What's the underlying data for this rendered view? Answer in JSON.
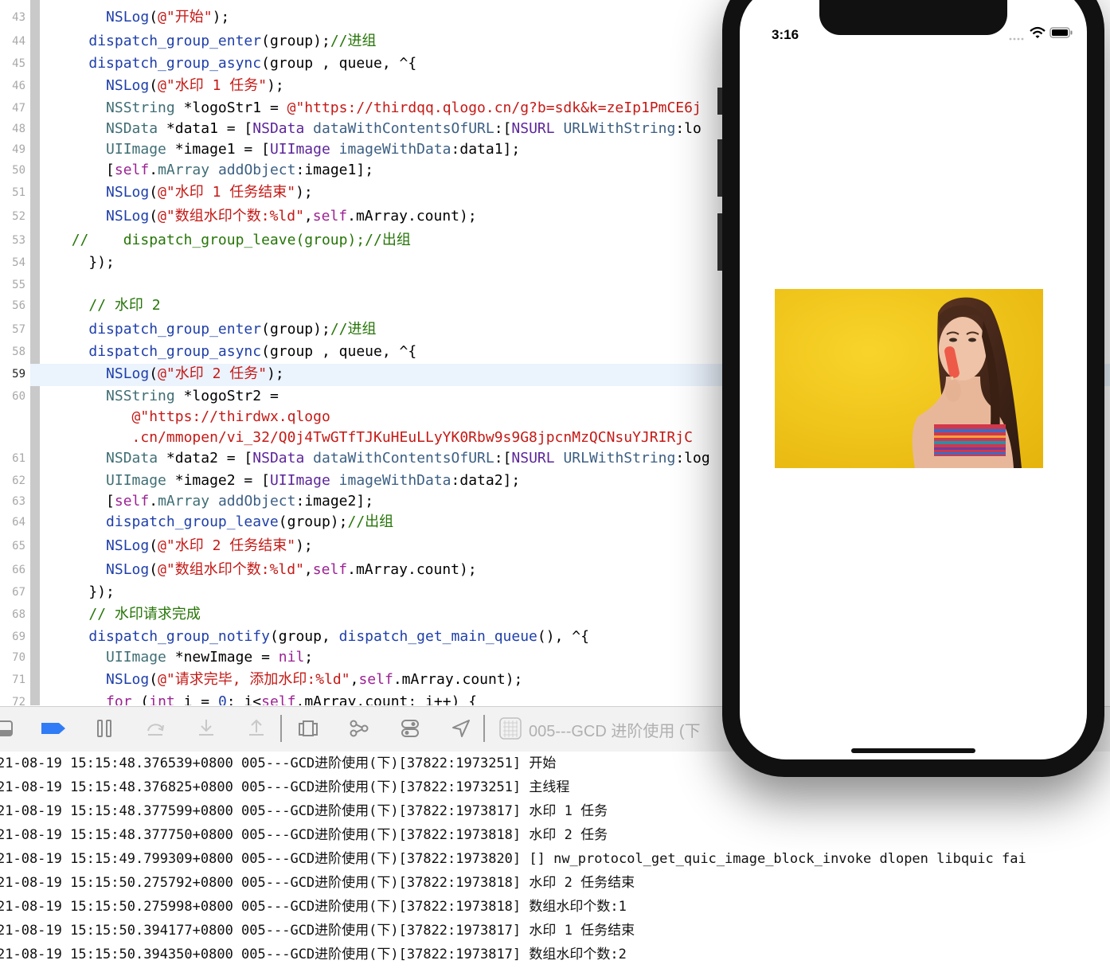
{
  "editor": {
    "lines": [
      {
        "n": "43",
        "segs": [
          [
            "NSLog",
            "fn"
          ],
          [
            "(",
            ""
          ],
          [
            "@\"开始\"",
            "str"
          ],
          [
            ");",
            ""
          ]
        ],
        "indent": "      "
      },
      {
        "n": "44",
        "segs": [
          [
            "dispatch_group_enter",
            "fn"
          ],
          [
            "(group);",
            ""
          ],
          [
            "//进组",
            "cm"
          ]
        ],
        "indent": "    "
      },
      {
        "n": "45",
        "segs": [
          [
            "dispatch_group_async",
            "fn"
          ],
          [
            "(group , queue, ^{",
            ""
          ]
        ],
        "indent": "    "
      },
      {
        "n": "46",
        "segs": [
          [
            "NSLog",
            "fn"
          ],
          [
            "(",
            ""
          ],
          [
            "@\"水印 1 任务\"",
            "str"
          ],
          [
            ");",
            ""
          ]
        ],
        "indent": "      "
      },
      {
        "n": "47",
        "segs": [
          [
            "NSString",
            "cls"
          ],
          [
            " *logoStr1 = ",
            ""
          ],
          [
            "@\"https://thirdqq.qlogo.cn/g?b=sdk&k=zeIp1PmCE6j",
            "str"
          ]
        ],
        "indent": "      "
      },
      {
        "n": "48",
        "segs": [
          [
            "NSData",
            "cls"
          ],
          [
            " *data1 = [",
            ""
          ],
          [
            "NSData",
            "cls2"
          ],
          [
            " ",
            ""
          ],
          [
            "dataWithContentsOfURL",
            "meth"
          ],
          [
            ":[",
            ""
          ],
          [
            "NSURL",
            "cls2"
          ],
          [
            " ",
            ""
          ],
          [
            "URLWithString",
            "meth"
          ],
          [
            ":lo",
            ""
          ]
        ],
        "indent": "      "
      },
      {
        "n": "49",
        "segs": [
          [
            "UIImage",
            "cls"
          ],
          [
            " *image1 = [",
            ""
          ],
          [
            "UIImage",
            "cls2"
          ],
          [
            " ",
            ""
          ],
          [
            "imageWithData",
            "meth"
          ],
          [
            ":data1];",
            ""
          ]
        ],
        "indent": "      "
      },
      {
        "n": "50",
        "segs": [
          [
            "[",
            ""
          ],
          [
            "self",
            "kw"
          ],
          [
            ".",
            ""
          ],
          [
            "mArray",
            "prop"
          ],
          [
            " ",
            ""
          ],
          [
            "addObject",
            "meth"
          ],
          [
            ":image1];",
            ""
          ]
        ],
        "indent": "      "
      },
      {
        "n": "51",
        "segs": [
          [
            "NSLog",
            "fn"
          ],
          [
            "(",
            ""
          ],
          [
            "@\"水印 1 任务结束\"",
            "str"
          ],
          [
            ");",
            ""
          ]
        ],
        "indent": "      "
      },
      {
        "n": "52",
        "segs": [
          [
            "NSLog",
            "fn"
          ],
          [
            "(",
            ""
          ],
          [
            "@\"数组水印个数:%ld\"",
            "str"
          ],
          [
            ",",
            ""
          ],
          [
            "self",
            "kw"
          ],
          [
            ".mArray.count);",
            ""
          ]
        ],
        "indent": "      "
      },
      {
        "n": "53",
        "segs": [
          [
            "//    dispatch_group_leave(group);//出组",
            "cm"
          ]
        ],
        "indent": "  "
      },
      {
        "n": "54",
        "segs": [
          [
            "});",
            ""
          ]
        ],
        "indent": "    "
      },
      {
        "n": "55",
        "segs": [],
        "indent": ""
      },
      {
        "n": "56",
        "segs": [
          [
            "// 水印 2",
            "cm"
          ]
        ],
        "indent": "    "
      },
      {
        "n": "57",
        "segs": [
          [
            "dispatch_group_enter",
            "fn"
          ],
          [
            "(group);",
            ""
          ],
          [
            "//进组",
            "cm"
          ]
        ],
        "indent": "    "
      },
      {
        "n": "58",
        "segs": [
          [
            "dispatch_group_async",
            "fn"
          ],
          [
            "(group , queue, ^{",
            ""
          ]
        ],
        "indent": "    "
      },
      {
        "n": "59",
        "segs": [
          [
            "NSLog",
            "fn"
          ],
          [
            "(",
            ""
          ],
          [
            "@\"水印 2 任务\"",
            "str"
          ],
          [
            ");",
            ""
          ]
        ],
        "indent": "      "
      },
      {
        "n": "60",
        "segs": [
          [
            "NSString",
            "cls"
          ],
          [
            " *logoStr2 =",
            ""
          ]
        ],
        "indent": "      "
      },
      {
        "n": "",
        "segs": [
          [
            "@\"https://thirdwx.qlogo",
            "str"
          ]
        ],
        "indent": "         "
      },
      {
        "n": "",
        "segs": [
          [
            ".cn/mmopen/vi_32/Q0j4TwGTfTJKuHEuLLyYK0Rbw9s9G8jpcnMzQCNsuYJRIRjC",
            "str"
          ]
        ],
        "indent": "         "
      },
      {
        "n": "61",
        "segs": [
          [
            "NSData",
            "cls"
          ],
          [
            " *data2 = [",
            ""
          ],
          [
            "NSData",
            "cls2"
          ],
          [
            " ",
            ""
          ],
          [
            "dataWithContentsOfURL",
            "meth"
          ],
          [
            ":[",
            ""
          ],
          [
            "NSURL",
            "cls2"
          ],
          [
            " ",
            ""
          ],
          [
            "URLWithString",
            "meth"
          ],
          [
            ":log",
            ""
          ]
        ],
        "indent": "      "
      },
      {
        "n": "62",
        "segs": [
          [
            "UIImage",
            "cls"
          ],
          [
            " *image2 = [",
            ""
          ],
          [
            "UIImage",
            "cls2"
          ],
          [
            " ",
            ""
          ],
          [
            "imageWithData",
            "meth"
          ],
          [
            ":data2];",
            ""
          ]
        ],
        "indent": "      "
      },
      {
        "n": "63",
        "segs": [
          [
            "[",
            ""
          ],
          [
            "self",
            "kw"
          ],
          [
            ".",
            ""
          ],
          [
            "mArray",
            "prop"
          ],
          [
            " ",
            ""
          ],
          [
            "addObject",
            "meth"
          ],
          [
            ":image2];",
            ""
          ]
        ],
        "indent": "      "
      },
      {
        "n": "64",
        "segs": [
          [
            "dispatch_group_leave",
            "fn"
          ],
          [
            "(group);",
            ""
          ],
          [
            "//出组",
            "cm"
          ]
        ],
        "indent": "      "
      },
      {
        "n": "65",
        "segs": [
          [
            "NSLog",
            "fn"
          ],
          [
            "(",
            ""
          ],
          [
            "@\"水印 2 任务结束\"",
            "str"
          ],
          [
            ");",
            ""
          ]
        ],
        "indent": "      "
      },
      {
        "n": "66",
        "segs": [
          [
            "NSLog",
            "fn"
          ],
          [
            "(",
            ""
          ],
          [
            "@\"数组水印个数:%ld\"",
            "str"
          ],
          [
            ",",
            ""
          ],
          [
            "self",
            "kw"
          ],
          [
            ".mArray.count);",
            ""
          ]
        ],
        "indent": "      "
      },
      {
        "n": "67",
        "segs": [
          [
            "});",
            ""
          ]
        ],
        "indent": "    "
      },
      {
        "n": "68",
        "segs": [
          [
            "// 水印请求完成",
            "cm"
          ]
        ],
        "indent": "    "
      },
      {
        "n": "69",
        "segs": [
          [
            "dispatch_group_notify",
            "fn"
          ],
          [
            "(group, ",
            ""
          ],
          [
            "dispatch_get_main_queue",
            "fn"
          ],
          [
            "(), ^{",
            ""
          ]
        ],
        "indent": "    "
      },
      {
        "n": "70",
        "segs": [
          [
            "UIImage",
            "cls"
          ],
          [
            " *newImage = ",
            ""
          ],
          [
            "nil",
            "kw"
          ],
          [
            ";",
            ""
          ]
        ],
        "indent": "      "
      },
      {
        "n": "71",
        "segs": [
          [
            "NSLog",
            "fn"
          ],
          [
            "(",
            ""
          ],
          [
            "@\"请求完毕, 添加水印:%ld\"",
            "str"
          ],
          [
            ",",
            ""
          ],
          [
            "self",
            "kw"
          ],
          [
            ".mArray.count);",
            ""
          ]
        ],
        "indent": "      "
      },
      {
        "n": "72",
        "segs": [
          [
            "for",
            "kw"
          ],
          [
            " (",
            ""
          ],
          [
            "int",
            "kw"
          ],
          [
            " i = ",
            ""
          ],
          [
            "0",
            "fn"
          ],
          [
            "; i<",
            ""
          ],
          [
            "self",
            "kw"
          ],
          [
            ".mArray.count; i++) {",
            ""
          ]
        ],
        "indent": "      "
      }
    ],
    "active_line": "59"
  },
  "debugbar": {
    "title": "005---GCD 进阶使用 (下",
    "icons": [
      "hide-console-icon",
      "breakpoints-icon",
      "pause-icon",
      "step-over-icon",
      "step-into-icon",
      "step-out-icon",
      "view-hierarchy-icon",
      "memory-graph-icon",
      "environment-overrides-icon",
      "simulate-location-icon",
      "target-app-icon"
    ]
  },
  "console": {
    "lines": [
      "21-08-19 15:15:48.376539+0800 005---GCD进阶使用(下)[37822:1973251] 开始",
      "21-08-19 15:15:48.376825+0800 005---GCD进阶使用(下)[37822:1973251] 主线程",
      "21-08-19 15:15:48.377599+0800 005---GCD进阶使用(下)[37822:1973817] 水印 1 任务",
      "21-08-19 15:15:48.377750+0800 005---GCD进阶使用(下)[37822:1973818] 水印 2 任务",
      "21-08-19 15:15:49.799309+0800 005---GCD进阶使用(下)[37822:1973820] [] nw_protocol_get_quic_image_block_invoke dlopen libquic fai",
      "21-08-19 15:15:50.275792+0800 005---GCD进阶使用(下)[37822:1973818] 水印 2 任务结束",
      "21-08-19 15:15:50.275998+0800 005---GCD进阶使用(下)[37822:1973818] 数组水印个数:1",
      "21-08-19 15:15:50.394177+0800 005---GCD进阶使用(下)[37822:1973817] 水印 1 任务结束",
      "21-08-19 15:15:50.394350+0800 005---GCD进阶使用(下)[37822:1973817] 数组水印个数:2"
    ]
  },
  "simulator": {
    "time": "3:16",
    "image_subject": "woman eating red popsicle on yellow background",
    "colors": {
      "background": "#f2c417",
      "frame": "#111111"
    }
  }
}
